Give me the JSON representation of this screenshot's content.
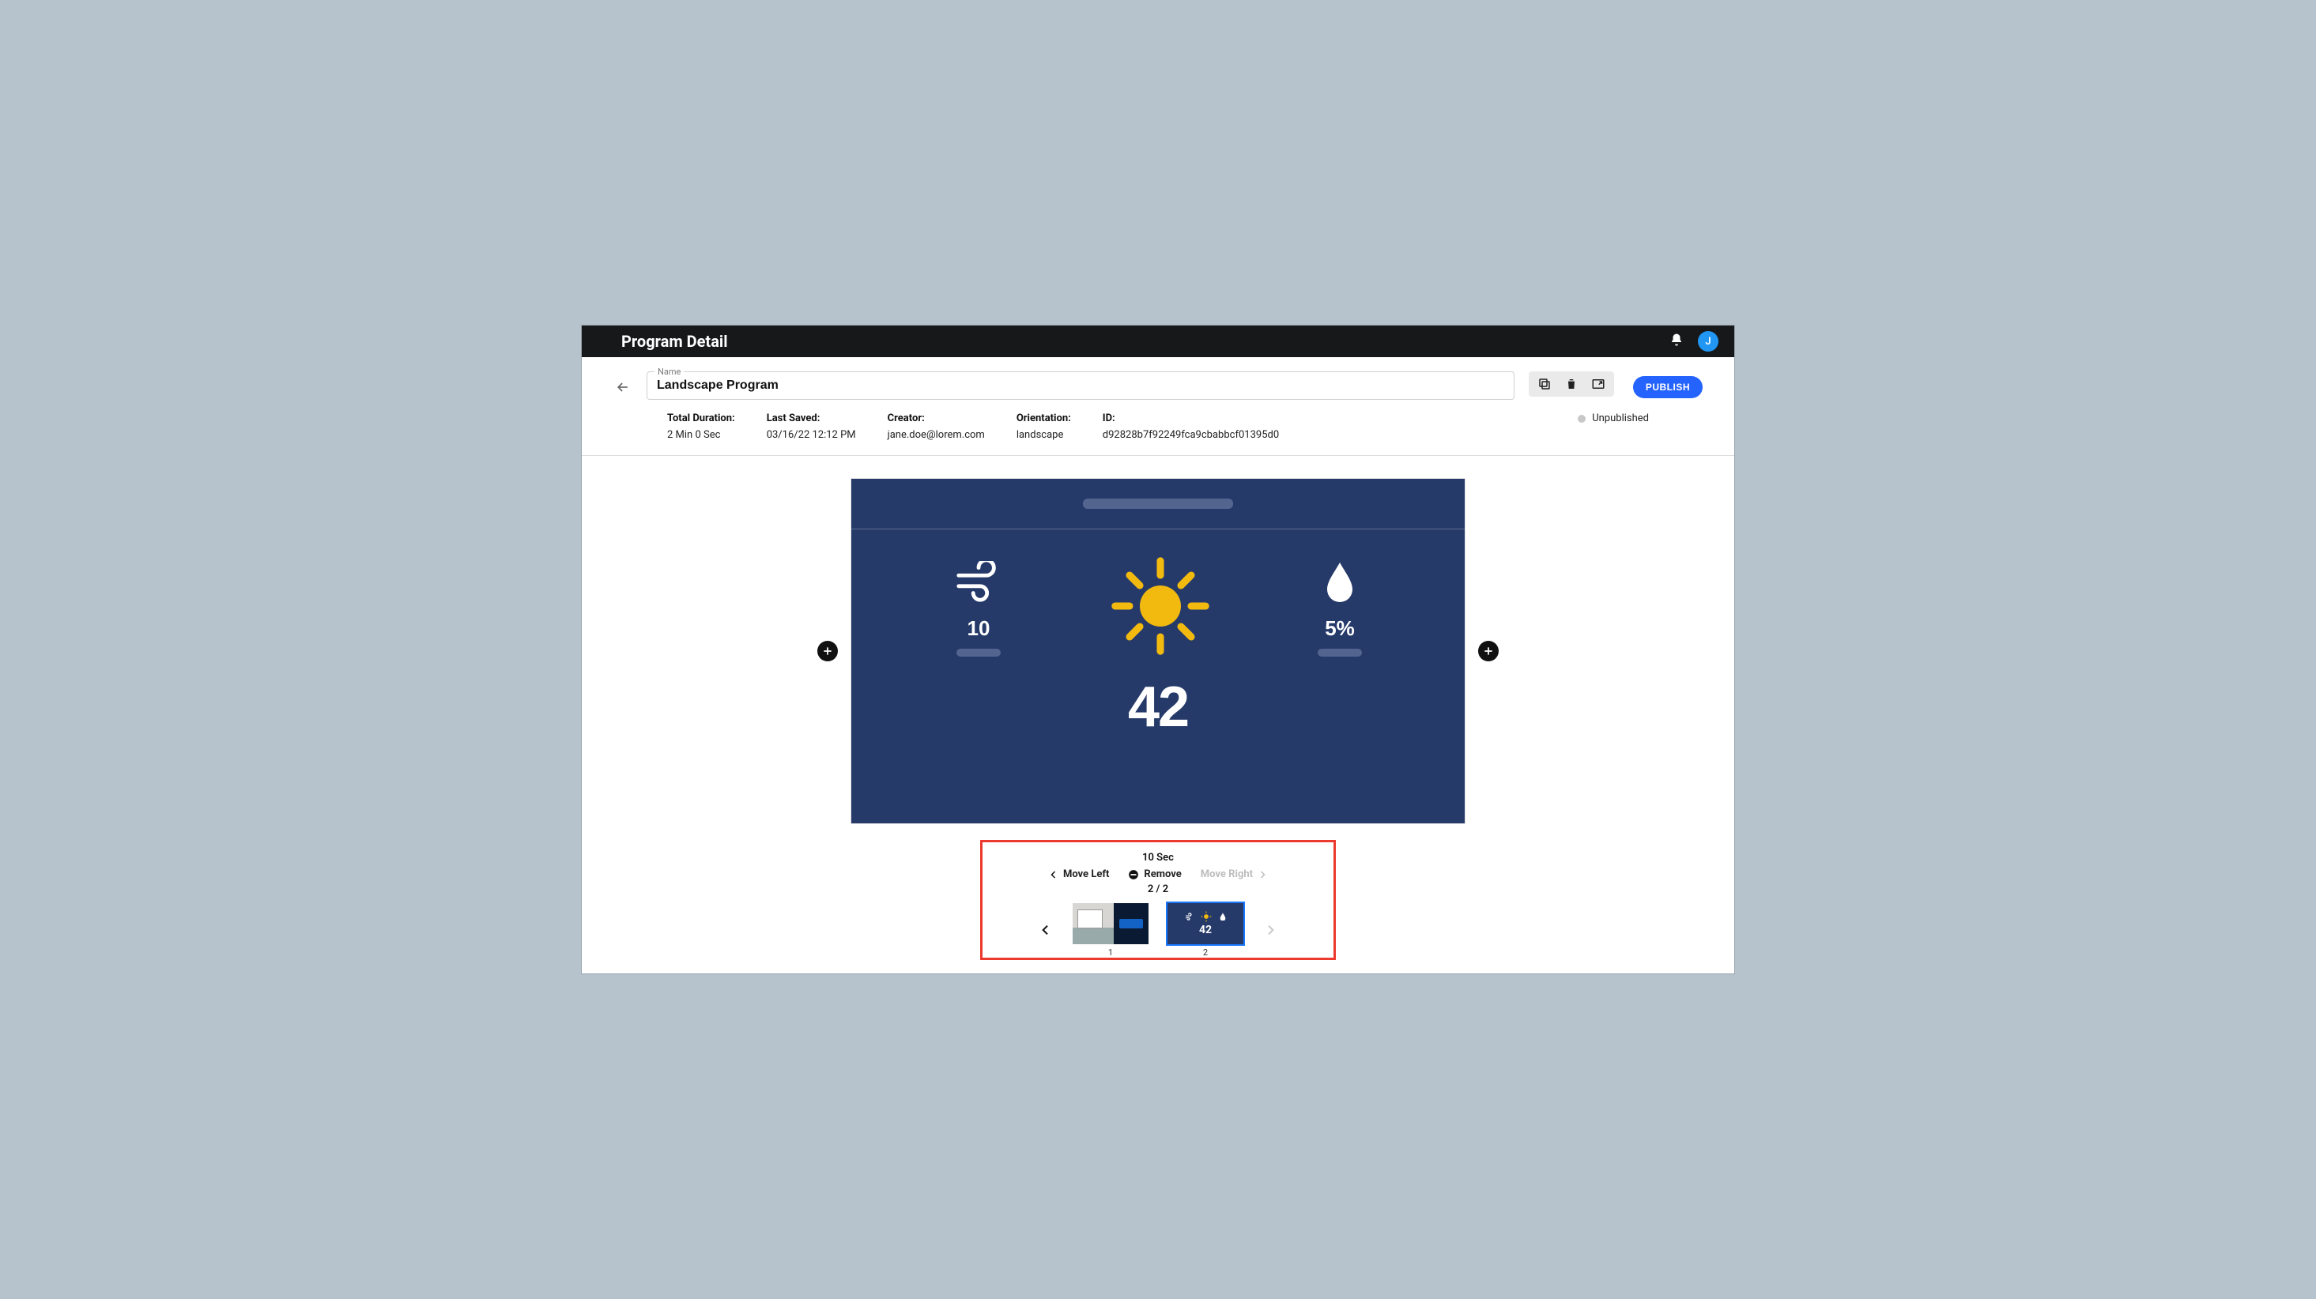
{
  "topbar": {
    "title": "Program Detail",
    "avatar_initial": "J"
  },
  "header": {
    "name_label": "Name",
    "name_value": "Landscape Program",
    "publish_label": "PUBLISH"
  },
  "meta": {
    "total_duration": {
      "label": "Total Duration:",
      "value": "2 Min 0 Sec"
    },
    "last_saved": {
      "label": "Last Saved:",
      "value": "03/16/22 12:12 PM"
    },
    "creator": {
      "label": "Creator:",
      "value": "jane.doe@lorem.com"
    },
    "orientation": {
      "label": "Orientation:",
      "value": "landscape"
    },
    "id": {
      "label": "ID:",
      "value": "d92828b7f92249fca9cbabbcf01395d0"
    },
    "status": "Unpublished"
  },
  "slide": {
    "wind_value": "10",
    "humidity_value": "5%",
    "temp_value": "42"
  },
  "panel": {
    "duration": "10 Sec",
    "move_left": "Move Left",
    "remove": "Remove",
    "move_right": "Move Right",
    "pager": "2 / 2",
    "thumb1_num": "1",
    "thumb2_num": "2"
  }
}
